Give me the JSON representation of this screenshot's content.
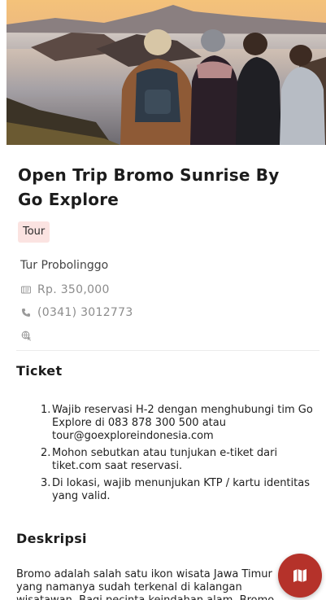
{
  "hero": {
    "image_description_icon": "sunrise-photo"
  },
  "event": {
    "title": "Open Trip Bromo Sunrise By Go Explore",
    "tag": "Tour",
    "city": "Tur Probolinggo",
    "price": "Rp. 350,000",
    "phone": "(0341) 3012773"
  },
  "ticket": {
    "heading": "Ticket",
    "items": [
      "Wajib reservasi H-2 dengan menghubungi tim Go Explore di 083 878 300 500 atau tour@goexploreindonesia.com",
      "Mohon sebutkan atau tunjukan e-tiket dari tiket.com saat reservasi.",
      "Di lokasi, wajib menunjukan KTP / kartu identitas yang valid."
    ]
  },
  "description": {
    "heading": "Deskripsi",
    "text": "Bromo adalah salah satu ikon wisata Jawa Timur yang namanya sudah terkenal di kalangan wisatawan. Bagi pecinta keindahan alam, Bromo"
  },
  "fab": {
    "icon": "map-icon"
  },
  "colors": {
    "accent": "#b5322a",
    "tag_bg": "#fbe3e1"
  }
}
